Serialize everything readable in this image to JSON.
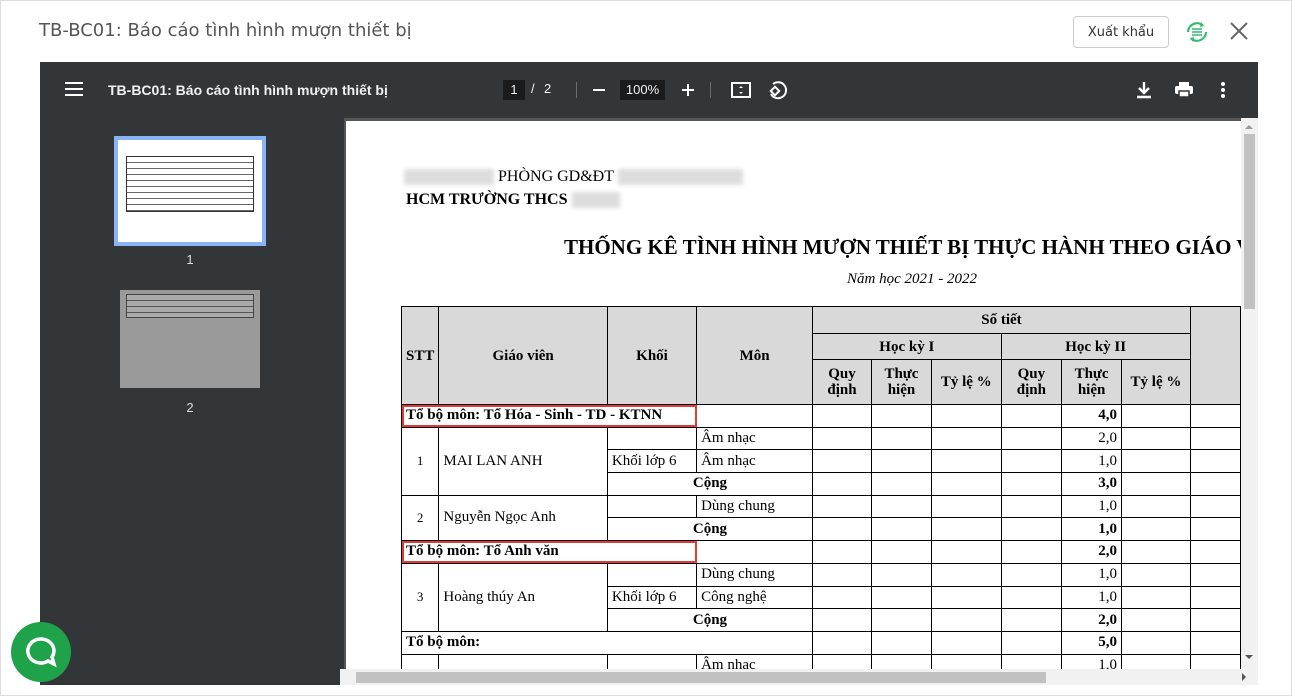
{
  "dialog": {
    "title": "TB-BC01: Báo cáo tình hình mượn thiết bị",
    "export_label": "Xuất khẩu"
  },
  "viewer": {
    "doc_title": "TB-BC01: Báo cáo tình hình mượn thiết bị",
    "current_page": "1",
    "separator": "/",
    "total_pages": "2",
    "zoom": "100%",
    "thumbs": [
      "1",
      "2"
    ]
  },
  "report": {
    "header_line1": "PHÒNG GD&ĐT",
    "header_line2": "HCM TRƯỜNG THCS",
    "title": "THỐNG KÊ TÌNH HÌNH MƯỢN THIẾT BỊ THỰC HÀNH THEO GIÁO VIÊN",
    "subtitle": "Năm học 2021 - 2022",
    "columns": {
      "stt": "STT",
      "teacher": "Giáo viên",
      "grade": "Khối",
      "subject": "Môn",
      "periods": "Số tiết",
      "sem1": "Học kỳ I",
      "sem2": "Học kỳ II",
      "planned": "Quy định",
      "done": "Thực hiện",
      "ratio": "Tỷ lệ %"
    },
    "total_label": "Cộng",
    "groups": [
      {
        "name": "Tổ bộ môn: Tổ Hóa - Sinh - TD - KTNN",
        "total": "4,0"
      },
      {
        "name": "Tổ bộ môn: Tổ Anh văn",
        "total": "2,0"
      },
      {
        "name": "Tổ bộ môn:",
        "total": "5,0"
      }
    ],
    "teachers": [
      {
        "stt": "1",
        "name": "MAI LAN ANH",
        "grade": "Khối lớp 6",
        "rows": [
          {
            "subject": "Âm nhạc",
            "done": "2,0"
          },
          {
            "subject": "Âm nhạc",
            "done": "1,0"
          }
        ],
        "total": "3,0"
      },
      {
        "stt": "2",
        "name": "Nguyễn Ngọc Anh",
        "rows": [
          {
            "subject": "Dùng chung",
            "done": "1,0"
          }
        ],
        "total": "1,0"
      },
      {
        "stt": "3",
        "name": "Hoàng thúy An",
        "grade": "Khối lớp 6",
        "rows": [
          {
            "subject": "Dùng chung",
            "done": "1,0"
          },
          {
            "subject": "Công nghệ",
            "done": "1,0"
          }
        ],
        "total": "2,0"
      },
      {
        "rows": [
          {
            "subject": "Âm nhạc",
            "done": "1,0"
          }
        ]
      }
    ]
  },
  "colors": {
    "toolbar": "#323639",
    "highlight": "#e53935",
    "accent": "#2ebd6b",
    "chat": "#1fa34a"
  }
}
